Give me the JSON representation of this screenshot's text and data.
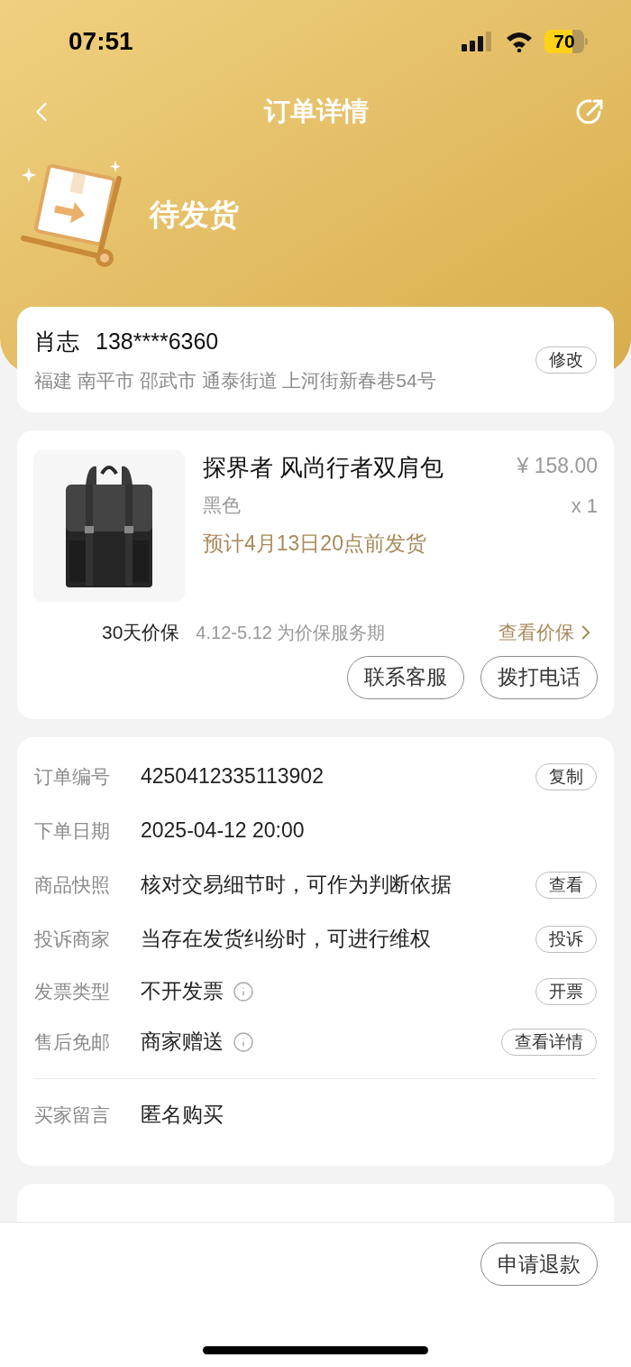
{
  "status_bar": {
    "time": "07:51",
    "battery": "70"
  },
  "nav": {
    "title": "订单详情"
  },
  "order_status": {
    "label": "待发货"
  },
  "address": {
    "name": "肖志",
    "phone": "138****6360",
    "detail": "福建 南平市 邵武市 通泰街道 上河街新春巷54号",
    "action": "修改"
  },
  "product": {
    "title": "探界者 风尚行者双肩包",
    "variant": "黑色",
    "delivery": "预计4月13日20点前发货",
    "price": "¥ 158.00",
    "quantity": "x 1",
    "protection": {
      "label": "30天价保",
      "period": "4.12-5.12 为价保服务期",
      "link": "查看价保"
    },
    "buttons": [
      "联系客服",
      "拨打电话"
    ]
  },
  "info_rows": [
    {
      "label": "订单编号",
      "value": "4250412335113902",
      "info": false,
      "action": "复制"
    },
    {
      "label": "下单日期",
      "value": "2025-04-12 20:00",
      "info": false
    },
    {
      "label": "商品快照",
      "value": "核对交易细节时，可作为判断依据",
      "info": false,
      "action": "查看"
    },
    {
      "label": "投诉商家",
      "value": "当存在发货纠纷时，可进行维权",
      "info": false,
      "action": "投诉"
    },
    {
      "label": "发票类型",
      "value": "不开发票",
      "info": true,
      "action": "开票"
    },
    {
      "label": "售后免邮",
      "value": "商家赠送",
      "info": true,
      "action": "查看详情"
    }
  ],
  "buyer_note": {
    "label": "买家留言",
    "value": "匿名购买"
  },
  "bottom_actions": [
    "申请退款"
  ]
}
